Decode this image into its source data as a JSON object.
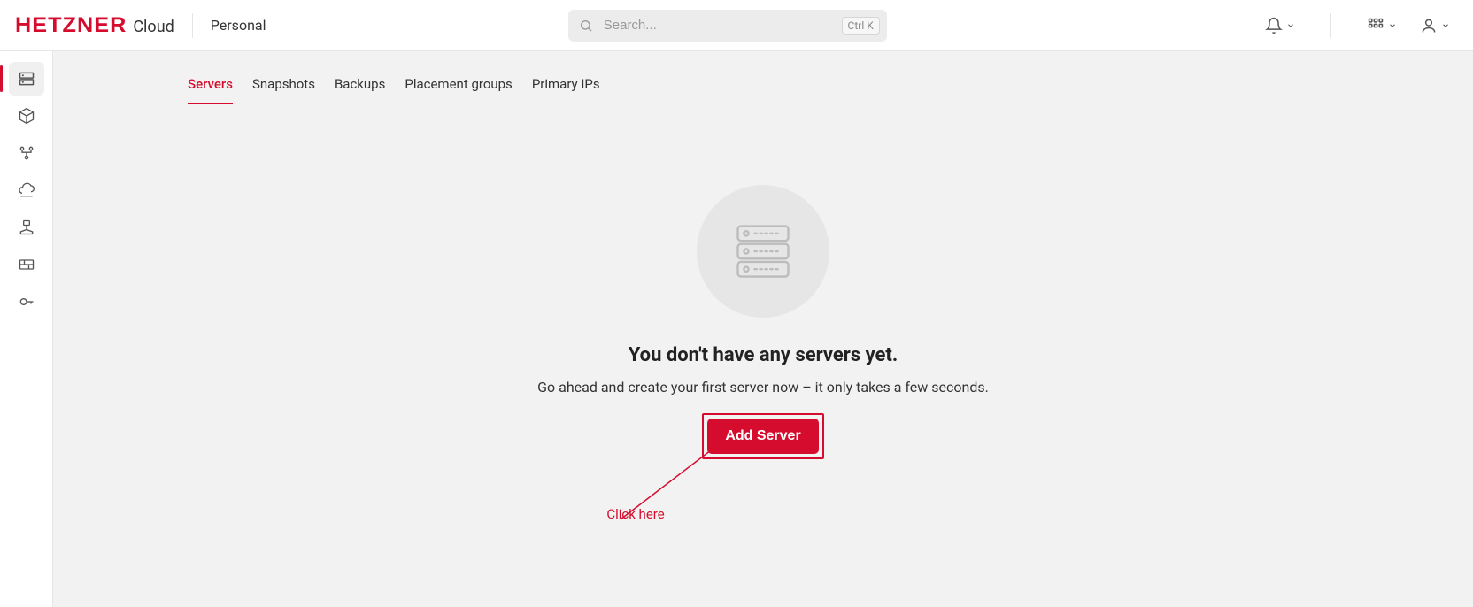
{
  "brand": {
    "logo_text": "HETZNER",
    "suffix": "Cloud"
  },
  "project": {
    "name": "Personal"
  },
  "search": {
    "placeholder": "Search...",
    "shortcut": "Ctrl K"
  },
  "sidebar": {
    "items": [
      {
        "name": "servers",
        "active": true
      },
      {
        "name": "volumes",
        "active": false
      },
      {
        "name": "load-balancers",
        "active": false
      },
      {
        "name": "floating-ips",
        "active": false
      },
      {
        "name": "networks",
        "active": false
      },
      {
        "name": "firewalls",
        "active": false
      },
      {
        "name": "ssh-keys",
        "active": false
      }
    ]
  },
  "tabs": {
    "items": [
      {
        "label": "Servers",
        "active": true
      },
      {
        "label": "Snapshots",
        "active": false
      },
      {
        "label": "Backups",
        "active": false
      },
      {
        "label": "Placement groups",
        "active": false
      },
      {
        "label": "Primary IPs",
        "active": false
      }
    ]
  },
  "empty": {
    "title": "You don't have any servers yet.",
    "subtitle": "Go ahead and create your first server now – it only takes a few seconds.",
    "button_label": "Add Server"
  },
  "annotation": {
    "label": "Click here"
  }
}
